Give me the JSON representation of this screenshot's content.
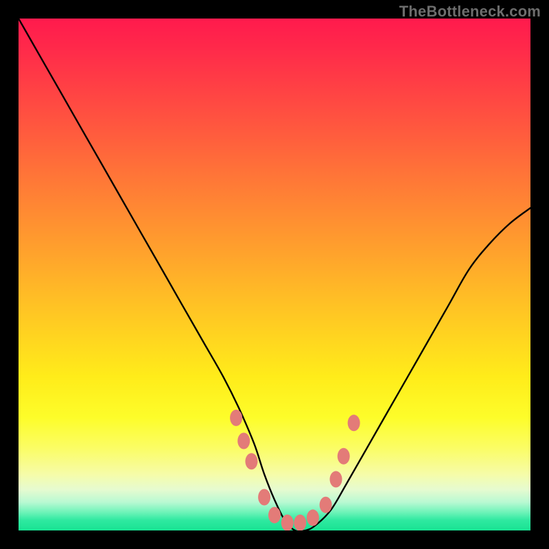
{
  "watermark": "TheBottleneck.com",
  "chart_data": {
    "type": "line",
    "title": "",
    "xlabel": "",
    "ylabel": "",
    "xlim": [
      0,
      100
    ],
    "ylim": [
      0,
      100
    ],
    "gradient_stops": [
      {
        "pct": 0,
        "color": "#ff1a4d"
      },
      {
        "pct": 14,
        "color": "#ff4244"
      },
      {
        "pct": 30,
        "color": "#ff7338"
      },
      {
        "pct": 46,
        "color": "#ffa32c"
      },
      {
        "pct": 62,
        "color": "#ffd420"
      },
      {
        "pct": 78,
        "color": "#fdfd2a"
      },
      {
        "pct": 89,
        "color": "#f6fca8"
      },
      {
        "pct": 94,
        "color": "#b8f9d2"
      },
      {
        "pct": 100,
        "color": "#18e393"
      }
    ],
    "series": [
      {
        "name": "bottleneck-curve",
        "x": [
          0,
          4,
          8,
          12,
          16,
          20,
          24,
          28,
          32,
          36,
          40,
          43,
          46,
          48,
          50,
          52,
          54,
          56,
          58,
          61,
          64,
          68,
          72,
          76,
          80,
          84,
          88,
          92,
          96,
          100
        ],
        "y": [
          100,
          93,
          86,
          79,
          72,
          65,
          58,
          51,
          44,
          37,
          30,
          24,
          17,
          11,
          6,
          2,
          0,
          0,
          1,
          4,
          9,
          16,
          23,
          30,
          37,
          44,
          51,
          56,
          60,
          63
        ]
      }
    ],
    "markers": [
      {
        "x": 42.5,
        "y": 22.0
      },
      {
        "x": 44.0,
        "y": 17.5
      },
      {
        "x": 45.5,
        "y": 13.5
      },
      {
        "x": 48.0,
        "y": 6.5
      },
      {
        "x": 50.0,
        "y": 3.0
      },
      {
        "x": 52.5,
        "y": 1.5
      },
      {
        "x": 55.0,
        "y": 1.5
      },
      {
        "x": 57.5,
        "y": 2.5
      },
      {
        "x": 60.0,
        "y": 5.0
      },
      {
        "x": 62.0,
        "y": 10.0
      },
      {
        "x": 63.5,
        "y": 14.5
      },
      {
        "x": 65.5,
        "y": 21.0
      }
    ],
    "marker_color": "#e37b78",
    "curve_color": "#000000"
  }
}
